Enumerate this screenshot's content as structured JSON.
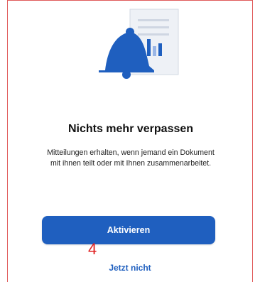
{
  "dialog": {
    "title": "Nichts mehr verpassen",
    "description": "Mitteilungen erhalten, wenn jemand ein Dokument mit ihnen teilt oder mit Ihnen zusammenarbeitet.",
    "primary_button": "Aktivieren",
    "secondary_link": "Jetzt nicht"
  },
  "annotation": {
    "marker": "4"
  },
  "illustration": {
    "icons": [
      "bell-icon",
      "document-icon",
      "bar-chart-icon"
    ],
    "colors": {
      "bell": "#1f5fbf",
      "document": "#eef1f6",
      "chart_dark": "#1f5fbf",
      "chart_light": "#9ab6e6"
    }
  },
  "colors": {
    "accent": "#1f5fbf",
    "frame": "#e05a5a",
    "marker": "#e02020"
  }
}
